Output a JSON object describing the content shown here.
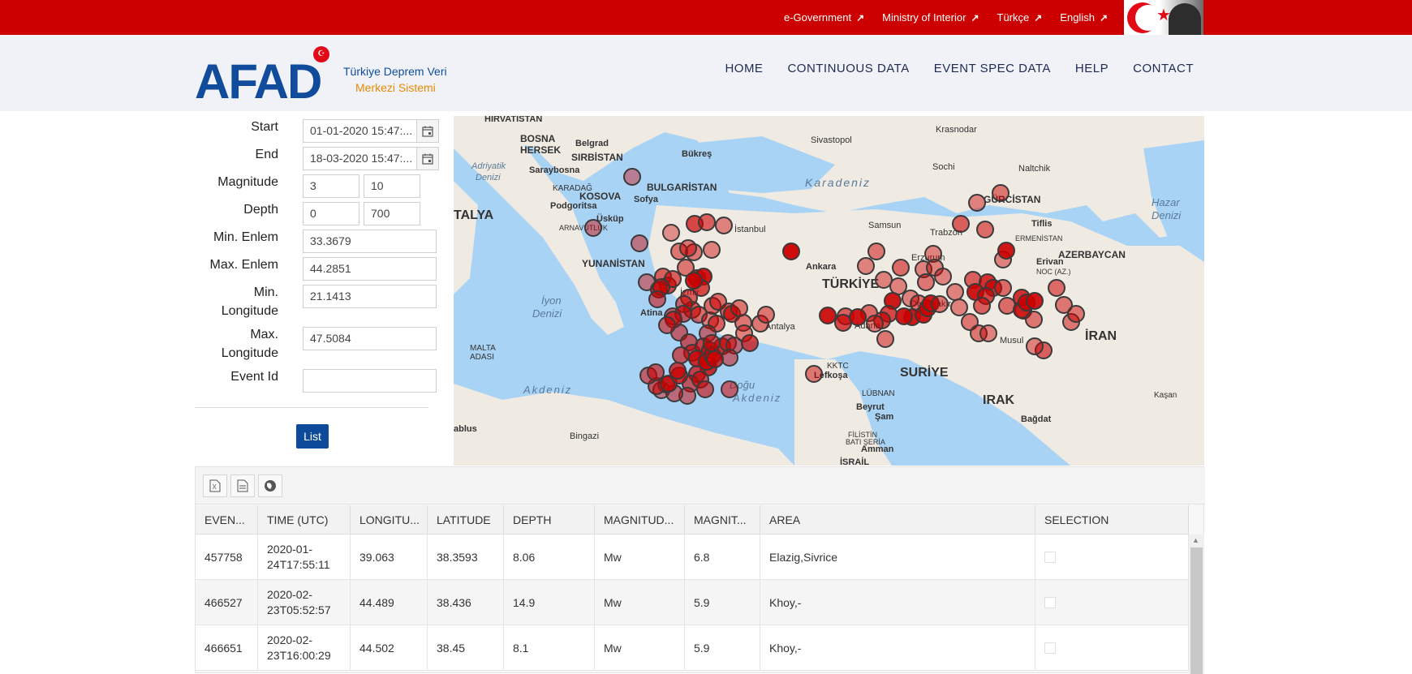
{
  "topbar": {
    "links": [
      {
        "label": "e-Government"
      },
      {
        "label": "Ministry of Interior"
      },
      {
        "label": "Türkçe"
      },
      {
        "label": "English"
      }
    ]
  },
  "header": {
    "logo": "AFAD",
    "subtitle1": "Türkiye Deprem Veri",
    "subtitle2": "Merkezi Sistemi",
    "nav": [
      "HOME",
      "CONTINUOUS DATA",
      "EVENT SPEC DATA",
      "HELP",
      "CONTACT"
    ]
  },
  "form": {
    "start_label": "Start",
    "start_value": "01-01-2020 15:47:...",
    "end_label": "End",
    "end_value": "18-03-2020 15:47:...",
    "magnitude_label": "Magnitude",
    "magnitude_min": "3",
    "magnitude_max": "10",
    "depth_label": "Depth",
    "depth_min": "0",
    "depth_max": "700",
    "min_lat_label": "Min. Enlem",
    "min_lat": "33.3679",
    "max_lat_label": "Max. Enlem",
    "max_lat": "44.2851",
    "min_lon_label1": "Min.",
    "min_lon_label2": "Longitude",
    "min_lon": "21.1413",
    "max_lon_label1": "Max.",
    "max_lon_label2": "Longitude",
    "max_lon": "47.5084",
    "event_id_label": "Event Id",
    "event_id": "",
    "list_button": "List"
  },
  "map": {
    "labels": [
      {
        "text": "HIRVATİSTAN"
      },
      {
        "text": "BOSNA"
      },
      {
        "text": "HERSEK"
      },
      {
        "text": "Belgrad"
      },
      {
        "text": "SIRBİSTAN"
      },
      {
        "text": "Sivastopol"
      },
      {
        "text": "Krasnodar"
      },
      {
        "text": "Bükreş"
      },
      {
        "text": "Adriyatik"
      },
      {
        "text": "Denizi"
      },
      {
        "text": "Saraybosna"
      },
      {
        "text": "BULGARİSTAN"
      },
      {
        "text": "KARADAĞ"
      },
      {
        "text": "KOSOVA"
      },
      {
        "text": "Sofya"
      },
      {
        "text": "Podgoritsa"
      },
      {
        "text": "Karadeniz"
      },
      {
        "text": "Sochi"
      },
      {
        "text": "Naltchik"
      },
      {
        "text": "GÜRCİSTAN"
      },
      {
        "text": "Hazar"
      },
      {
        "text": "Denizi"
      },
      {
        "text": "TALYA"
      },
      {
        "text": "Üsküp"
      },
      {
        "text": "ARNAVUTLUK"
      },
      {
        "text": "İstanbul"
      },
      {
        "text": "Samsun"
      },
      {
        "text": "Trabzon"
      },
      {
        "text": "Tiflis"
      },
      {
        "text": "ERMENİSTAN"
      },
      {
        "text": "AZERBAYCAN"
      },
      {
        "text": "YUNANİSTAN"
      },
      {
        "text": "Ankara"
      },
      {
        "text": "Erzurum"
      },
      {
        "text": "Erivan"
      },
      {
        "text": "NOC (AZ.)"
      },
      {
        "text": "İyon"
      },
      {
        "text": "Denizi"
      },
      {
        "text": "TÜRKİYE"
      },
      {
        "text": "İzmir"
      },
      {
        "text": "Diyarbakır"
      },
      {
        "text": "Atina"
      },
      {
        "text": "Adana"
      },
      {
        "text": "Antalya"
      },
      {
        "text": "İRAN"
      },
      {
        "text": "MALTA"
      },
      {
        "text": "ADASI"
      },
      {
        "text": "Musul"
      },
      {
        "text": "KKTC"
      },
      {
        "text": "Lefkoşa"
      },
      {
        "text": "SURİYE"
      },
      {
        "text": "Akdeniz"
      },
      {
        "text": "Doğu"
      },
      {
        "text": "Akdeniz"
      },
      {
        "text": "IRAK"
      },
      {
        "text": "LÜBNAN"
      },
      {
        "text": "Kaşan"
      },
      {
        "text": "Beyrut"
      },
      {
        "text": "Şam"
      },
      {
        "text": "Bağdat"
      },
      {
        "text": "ablus"
      },
      {
        "text": "Bingazi"
      },
      {
        "text": "FİLİSTİN"
      },
      {
        "text": "BATI ŞERİA"
      },
      {
        "text": "Amman"
      },
      {
        "text": "İSRAİL"
      }
    ],
    "marker_color": "#cc0000"
  },
  "table": {
    "toolbar": [
      "excel-icon",
      "csv-icon",
      "globe-icon"
    ],
    "columns": [
      "EVEN...",
      "TIME (UTC)",
      "LONGITU...",
      "LATITUDE",
      "DEPTH",
      "MAGNITUD...",
      "MAGNIT...",
      "AREA",
      "SELECTION"
    ],
    "rows": [
      {
        "id": "457758",
        "time1": "2020-01-",
        "time2": "24T17:55:11",
        "lon": "39.063",
        "lat": "38.3593",
        "depth": "8.06",
        "type": "Mw",
        "mag": "6.8",
        "area": "Elazig,Sivrice"
      },
      {
        "id": "466527",
        "time1": "2020-02-",
        "time2": "23T05:52:57",
        "lon": "44.489",
        "lat": "38.436",
        "depth": "14.9",
        "type": "Mw",
        "mag": "5.9",
        "area": "Khoy,-"
      },
      {
        "id": "466651",
        "time1": "2020-02-",
        "time2": "23T16:00:29",
        "lon": "44.502",
        "lat": "38.45",
        "depth": "8.1",
        "type": "Mw",
        "mag": "5.9",
        "area": "Khoy,-"
      }
    ]
  }
}
